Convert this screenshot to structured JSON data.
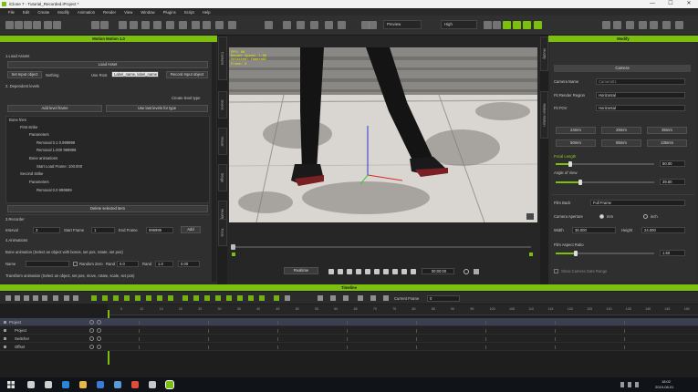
{
  "titlebar": {
    "title": "iClone 7 - Tutorial_Recorded.iProject *",
    "min": "—",
    "max": "☐",
    "close": "✕"
  },
  "menu": [
    "File",
    "Edit",
    "Create",
    "Modify",
    "Animation",
    "Render",
    "View",
    "Window",
    "Plugins",
    "Script",
    "Help"
  ],
  "toolbar": {
    "quality": "Preview",
    "quality2": "High"
  },
  "left_panel": {
    "header": "Motion Motion 1.0",
    "load_section": "1.Load Assets",
    "load_button": "Load Asset",
    "set_input_object": "Set Input object",
    "nothing_label": "Nothing",
    "use_root_label": "Use Root",
    "use_root_value": "Label_name, label_name",
    "record_input_button": "Record Input object",
    "dependent_section": "2. Dependent levels",
    "create_level_type": "Create level type",
    "add_level_frames": "Add level frame",
    "use_last_levels": "Use last levels for type",
    "tree": {
      "root": "Bone fries",
      "first_child": "First strike",
      "parameters": "Parameters",
      "removal": "Removal 0.1 0.999999",
      "removal2": "Removal 1.000 999999",
      "bone_animations": "Bone animations",
      "start_frame": "Start Load Frame: 100.000",
      "second": "Second strike",
      "parameters2": "Parameters",
      "removal3": "Removal 0.0 999999"
    },
    "delete_button": "Delete selected item",
    "recorder_section": "3.Recorder",
    "interval_label": "Interval",
    "interval_value": "3",
    "start_frame_label": "Start Frame",
    "start_frame_value": "1",
    "end_frame_label": "End Frame",
    "end_frame_value": "999999",
    "add_label": "Add",
    "animations_section": "4.Animations",
    "bone_anim_desc": "Bone animation (Select an object with bones, set pos, rotate, set pos)",
    "name_label": "Name",
    "random_label": "Random",
    "zero_label": "Zero",
    "rand_label": "Rand",
    "rand_value": "Rand",
    "value_a": "0.0",
    "value_b": "1.0",
    "value_c": "0.00",
    "transform_desc": "Transform animation (Select an object, set pos, move, rotate, scale, set pos)"
  },
  "side_tabs_left": [
    "Content",
    "Scene",
    "Visual",
    "Stage",
    "Modify",
    "Tools"
  ],
  "side_tabs_right": [
    "Modify",
    "Motion Motion"
  ],
  "viewport": {
    "overlay_lines": [
      "FPS: 60",
      "Render Speed: 1.00",
      "Selected: Camera01",
      "Frame: 0"
    ]
  },
  "playback": {
    "realtime": "Realtime",
    "timecode": "00:00:00"
  },
  "right_panel": {
    "header": "Modify",
    "tab": "Camera",
    "camera_name_label": "Camera Name",
    "camera_name_value": "Camera01",
    "fit_render_label": "Fit Render Region",
    "fit_render_value": "Horizontal",
    "fit_fov_label": "Fit FOV",
    "fit_fov_value": "Horizontal",
    "lens_buttons": [
      "24mm",
      "28mm",
      "35mm",
      "50mm",
      "85mm",
      "135mm"
    ],
    "focal_length_label": "Focal Length",
    "focal_length_value": "50.00",
    "focal_length_level": 0.15,
    "angle_label": "Angle of View",
    "angle_value": "39.60",
    "angle_level": 0.25,
    "film_back_label": "Film Back",
    "film_back_value": "Full Frame",
    "aperture_label": "Camera Aperture",
    "aperture_mm": "mm",
    "aperture_inch": "inch",
    "width_label": "Width",
    "width_value": "36.000",
    "height_label": "Height",
    "height_value": "24.000",
    "aspect_label": "Film Aspect Ratio",
    "aspect_value": "1.50",
    "aspect_level": 0.2,
    "lock_label": "Show Camera Gate Range"
  },
  "timeline": {
    "header": "Timeline",
    "current_frame_label": "Current Frame",
    "current_frame_value": "0",
    "tracks": [
      "Project",
      "Project",
      "Switcher",
      "Offset"
    ],
    "ruler": [
      "5",
      "10",
      "15",
      "20",
      "25",
      "30",
      "35",
      "40",
      "45",
      "50",
      "55",
      "60",
      "65",
      "70",
      "75",
      "80",
      "85",
      "90",
      "95",
      "100",
      "105",
      "110",
      "115",
      "120",
      "125",
      "130",
      "135",
      "140",
      "145",
      "150"
    ]
  },
  "taskbar": {
    "time": "18:02",
    "date": "2019-08-01"
  },
  "colors": {
    "accent": "#7cbf0f",
    "panel": "#2c2c2c",
    "dark": "#1e1e1e"
  }
}
